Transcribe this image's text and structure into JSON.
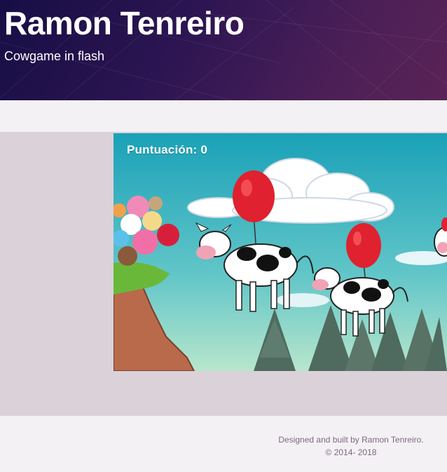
{
  "header": {
    "title": "Ramon Tenreiro",
    "subtitle": "Cowgame in flash"
  },
  "game": {
    "score_label": "Puntuación: 0"
  },
  "footer": {
    "credit": "Designed and built by Ramon Tenreiro.",
    "copyright": "© 2014- 2018"
  },
  "colors": {
    "header_start": "#170e45",
    "header_end": "#5a2356",
    "band": "#dbd1d9",
    "page_bg": "#f4f1f4",
    "sky_top": "#1aa1b8",
    "balloon": "#e0212f"
  }
}
